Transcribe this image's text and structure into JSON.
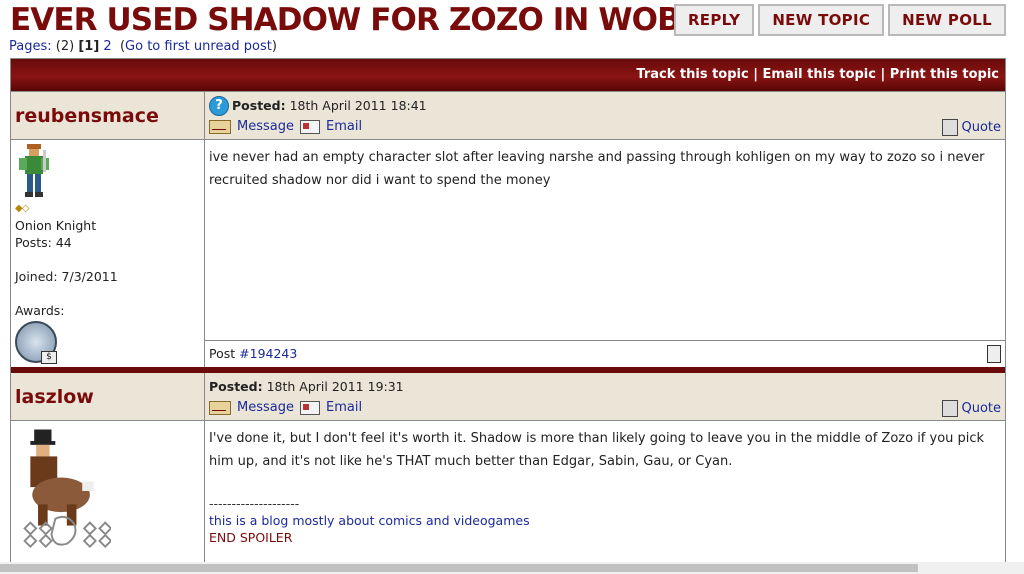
{
  "topic": {
    "title": "EVER USED SHADOW FOR ZOZO IN WOB?",
    "buttons": [
      "REPLY",
      "NEW TOPIC",
      "NEW POLL"
    ]
  },
  "pagination": {
    "pages_label": "Pages:",
    "count": "(2)",
    "current": "[1]",
    "next": "2",
    "first_unread": "Go to first unread post"
  },
  "topic_bar": {
    "track": "Track this topic",
    "email": "Email this topic",
    "print": "Print this topic"
  },
  "labels": {
    "posted": "Posted:",
    "message": "Message",
    "email": "Email",
    "quote": "Quote",
    "post_prefix": "Post"
  },
  "posts": [
    {
      "author": "reubensmace",
      "posted_date": "18th April 2011 18:41",
      "rank": "Onion Knight",
      "posts_count": "Posts: 44",
      "joined": "Joined: 7/3/2011",
      "awards_label": "Awards:",
      "body": "ive never had an empty character slot after leaving narshe and passing through kohligen on my way to zozo so i never recruited shadow nor did i want to spend the money",
      "post_id": "#194243"
    },
    {
      "author": "laszlow",
      "posted_date": "18th April 2011 19:31",
      "body": "I've done it, but I don't feel it's worth it. Shadow is more than likely going to leave you in the middle of Zozo if you pick him up, and it's not like he's THAT much better than Edgar, Sabin, Gau, or Cyan.",
      "sig_rule": "--------------------",
      "sig_link": "this is a blog mostly about comics and videogames",
      "spoiler_end": "END SPOILER"
    }
  ],
  "colors": {
    "brand": "#7a0b0b",
    "link": "#1a2a9a",
    "post_header_bg": "#ebe5d8"
  },
  "icons": [
    "question-mark-icon",
    "envelope-icon",
    "email-icon",
    "quote-icon",
    "back-to-top-icon"
  ]
}
